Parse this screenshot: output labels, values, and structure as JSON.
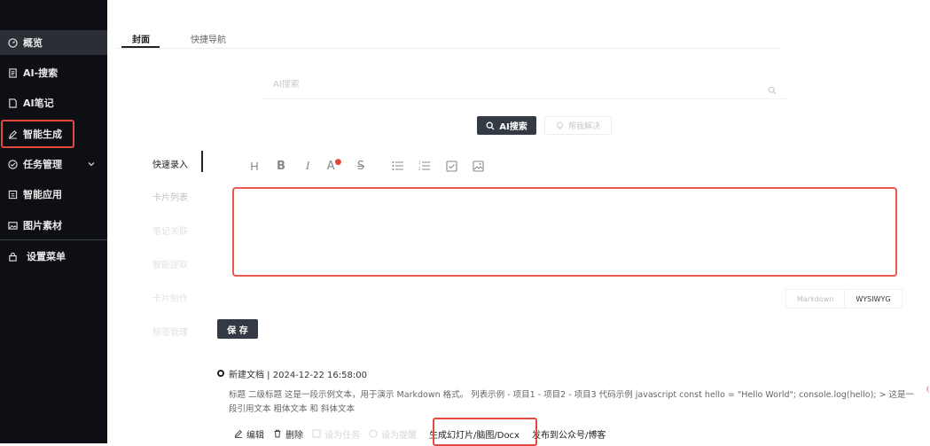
{
  "sidebar": {
    "items": [
      {
        "label": "概览",
        "icon": "dashboard-icon"
      },
      {
        "label": "AI-搜索",
        "icon": "search-doc-icon"
      },
      {
        "label": "AI笔记",
        "icon": "note-icon"
      },
      {
        "label": "智能生成",
        "icon": "pen-icon"
      },
      {
        "label": "任务管理",
        "icon": "check-circle-icon"
      },
      {
        "label": "智能应用",
        "icon": "app-icon"
      },
      {
        "label": "图片素材",
        "icon": "image-icon"
      },
      {
        "label": "设置菜单",
        "icon": "lock-icon"
      }
    ]
  },
  "tabs": [
    {
      "label": "封面"
    },
    {
      "label": "快捷导航"
    }
  ],
  "search": {
    "placeholder": "AI搜索",
    "button_label": "AI搜索",
    "help_label": "帮我解决"
  },
  "left_menu": {
    "items": [
      {
        "label": "快速录入"
      },
      {
        "label": "卡片列表"
      },
      {
        "label": "笔记关联"
      },
      {
        "label": "智能提取"
      },
      {
        "label": "卡片制作"
      },
      {
        "label": "标签管理"
      }
    ]
  },
  "toolbar": {
    "heading": "H",
    "bold": "B",
    "italic": "I",
    "color": "A",
    "strike": "S"
  },
  "editor": {
    "modes": [
      "Markdown",
      "WYSIWYG"
    ]
  },
  "save_label": "保 存",
  "doc": {
    "title": "新建文档 | 2024-12-22 16:58:00",
    "body": "标题 二级标题 这是一段示例文本，用于演示 Markdown 格式。 列表示例 - 项目1 - 项目2 - 项目3 代码示例 javascript const hello = \"Hello World\"; console.log(hello); > 这是一段引用文本 粗体文本 和 斜体文本",
    "actions": {
      "edit": "编辑",
      "delete": "删除",
      "set_task": "设为任务",
      "set_reminder": "设为提醒",
      "generate": "生成幻灯片/脑图/Docx",
      "publish": "发布到公众号/博客"
    }
  },
  "colors": {
    "sidebar_bg": "#0d0f14",
    "highlight": "#e04a3c",
    "primary_button": "#333a44"
  }
}
